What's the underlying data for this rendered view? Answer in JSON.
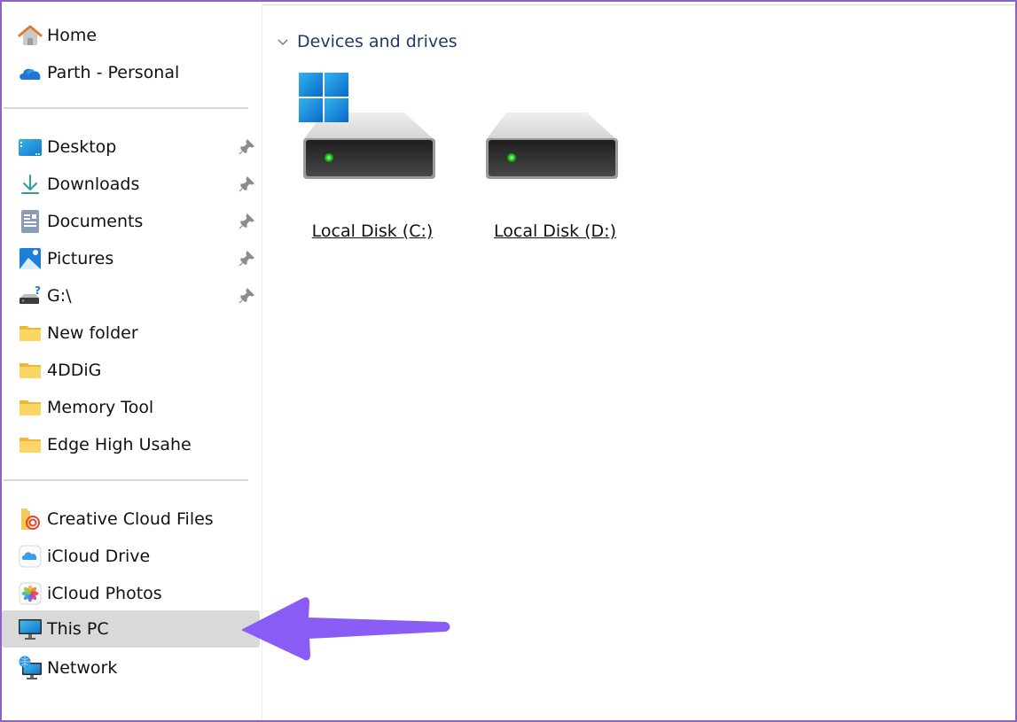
{
  "window": {
    "accent_border_color": "#8a63c6"
  },
  "sidebar": {
    "top_items": [
      {
        "label": "Home",
        "icon": "home-icon"
      },
      {
        "label": "Parth - Personal",
        "icon": "onedrive-cloud-icon"
      }
    ],
    "quick_access": [
      {
        "label": "Desktop",
        "icon": "desktop-icon",
        "pinned": true
      },
      {
        "label": "Downloads",
        "icon": "download-arrow-icon",
        "pinned": true
      },
      {
        "label": "Documents",
        "icon": "document-icon",
        "pinned": true
      },
      {
        "label": "Pictures",
        "icon": "pictures-icon",
        "pinned": true
      },
      {
        "label": "G:\\",
        "icon": "unknown-drive-icon",
        "pinned": true
      },
      {
        "label": "New folder",
        "icon": "folder-icon",
        "pinned": false
      },
      {
        "label": "4DDiG",
        "icon": "folder-icon",
        "pinned": false
      },
      {
        "label": "Memory Tool",
        "icon": "folder-icon",
        "pinned": false
      },
      {
        "label": "Edge High Usahe",
        "icon": "folder-icon",
        "pinned": false
      }
    ],
    "locations": [
      {
        "label": "Creative Cloud Files",
        "icon": "creative-cloud-folder-icon"
      },
      {
        "label": "iCloud Drive",
        "icon": "icloud-drive-icon"
      },
      {
        "label": "iCloud Photos",
        "icon": "icloud-photos-icon"
      },
      {
        "label": "This PC",
        "icon": "monitor-icon",
        "selected": true
      },
      {
        "label": "Network",
        "icon": "network-icon"
      }
    ]
  },
  "main": {
    "section_title": "Devices and drives",
    "section_expanded": true,
    "drives": [
      {
        "label": "Local Disk (C:)",
        "system_drive": true
      },
      {
        "label": "Local Disk (D:)",
        "system_drive": false
      }
    ]
  },
  "annotation": {
    "type": "arrow",
    "points_to": "This PC",
    "color": "#8a5cf6"
  }
}
